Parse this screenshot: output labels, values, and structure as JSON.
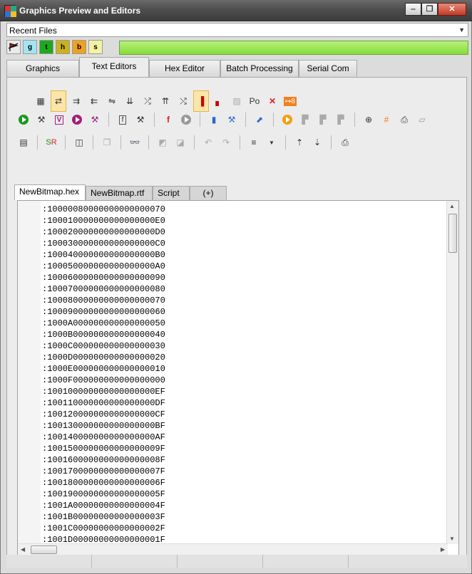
{
  "window": {
    "title": "Graphics Preview and Editors",
    "minimize": "‒",
    "maximize": "❐",
    "close": "✕"
  },
  "recent_files": {
    "label": "Recent Files",
    "arrow": "▼"
  },
  "quick_buttons": [
    {
      "label": "",
      "color": "#eaeaea",
      "icon": "flag-icon"
    },
    {
      "label": "g",
      "color": "#9fe6f2"
    },
    {
      "label": "t",
      "color": "#1ea81e"
    },
    {
      "label": "h",
      "color": "#c9b21e"
    },
    {
      "label": "b",
      "color": "#f0a21e"
    },
    {
      "label": "s",
      "color": "#f3f3a3"
    }
  ],
  "main_tabs": [
    "Graphics",
    "Text Editors",
    "Hex Editor",
    "Batch Processing",
    "Serial Com"
  ],
  "active_main_tab": "Text Editors",
  "toolbar": {
    "po_label": "Po"
  },
  "editor_tabs": [
    "NewBitmap.hex",
    "NewBitmap.rtf",
    "Script",
    "(+)"
  ],
  "active_editor_tab": "NewBitmap.hex",
  "hex_lines": [
    ":10000080000000000000070",
    ":100010000000000000000E0",
    ":100020000000000000000D0",
    ":100030000000000000000C0",
    ":100040000000000000000B0",
    ":100050000000000000000A0",
    ":10006000000000000000090",
    ":10007000000000000000080",
    ":10008000000000000000070",
    ":10009000000000000000060",
    ":1000A000000000000000050",
    ":1000B000000000000000040",
    ":1000C000000000000000030",
    ":1000D000000000000000020",
    ":1000E000000000000000010",
    ":1000F000000000000000000",
    ":100100000000000000000EF",
    ":100110000000000000000DF",
    ":100120000000000000000CF",
    ":100130000000000000000BF",
    ":100140000000000000000AF",
    ":1001500000000000000009F",
    ":1001600000000000000008F",
    ":1001700000000000000007F",
    ":1001800000000000000006F",
    ":1001900000000000000005F",
    ":1001A00000000000000004F",
    ":1001B00000000000000003F",
    ":1001C00000000000000002F",
    ":1001D00000000000000001F"
  ]
}
